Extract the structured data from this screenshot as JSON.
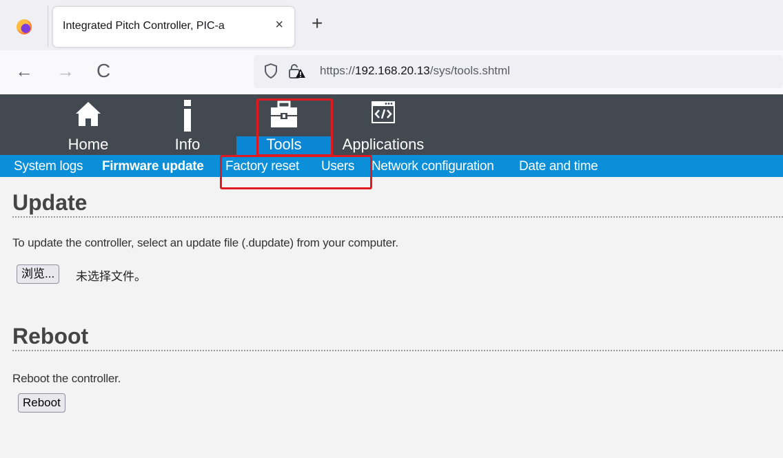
{
  "browser": {
    "tab_title": "Integrated Pitch Controller, PIC-a",
    "tab_close": "×",
    "new_tab": "+",
    "back": "←",
    "forward": "→",
    "reload": "C",
    "url_scheme": "https://",
    "url_host": "192.168.20.13",
    "url_path": "/sys/tools.shtml"
  },
  "header": {
    "nav": [
      {
        "label": "Home",
        "icon": "home-icon"
      },
      {
        "label": "Info",
        "icon": "info-icon"
      },
      {
        "label": "Tools",
        "icon": "toolbox-icon",
        "active": true
      },
      {
        "label": "Applications",
        "icon": "code-window-icon"
      }
    ]
  },
  "subnav": {
    "items": [
      {
        "label": "System logs"
      },
      {
        "label": "Firmware update",
        "active": true
      },
      {
        "label": "Factory reset"
      },
      {
        "label": "Users"
      },
      {
        "label": "Network configuration"
      },
      {
        "label": "Date and time"
      }
    ]
  },
  "update": {
    "title": "Update",
    "description": "To update the controller, select an update file (.dupdate) from your computer.",
    "browse_label": "浏览...",
    "file_status": "未选择文件。"
  },
  "reboot": {
    "title": "Reboot",
    "description": "Reboot the controller.",
    "button_label": "Reboot"
  },
  "colors": {
    "header_bg": "#434951",
    "subnav_bg": "#0a8fd8",
    "active_tab": "#0a86d4",
    "highlight": "#e0191f"
  }
}
